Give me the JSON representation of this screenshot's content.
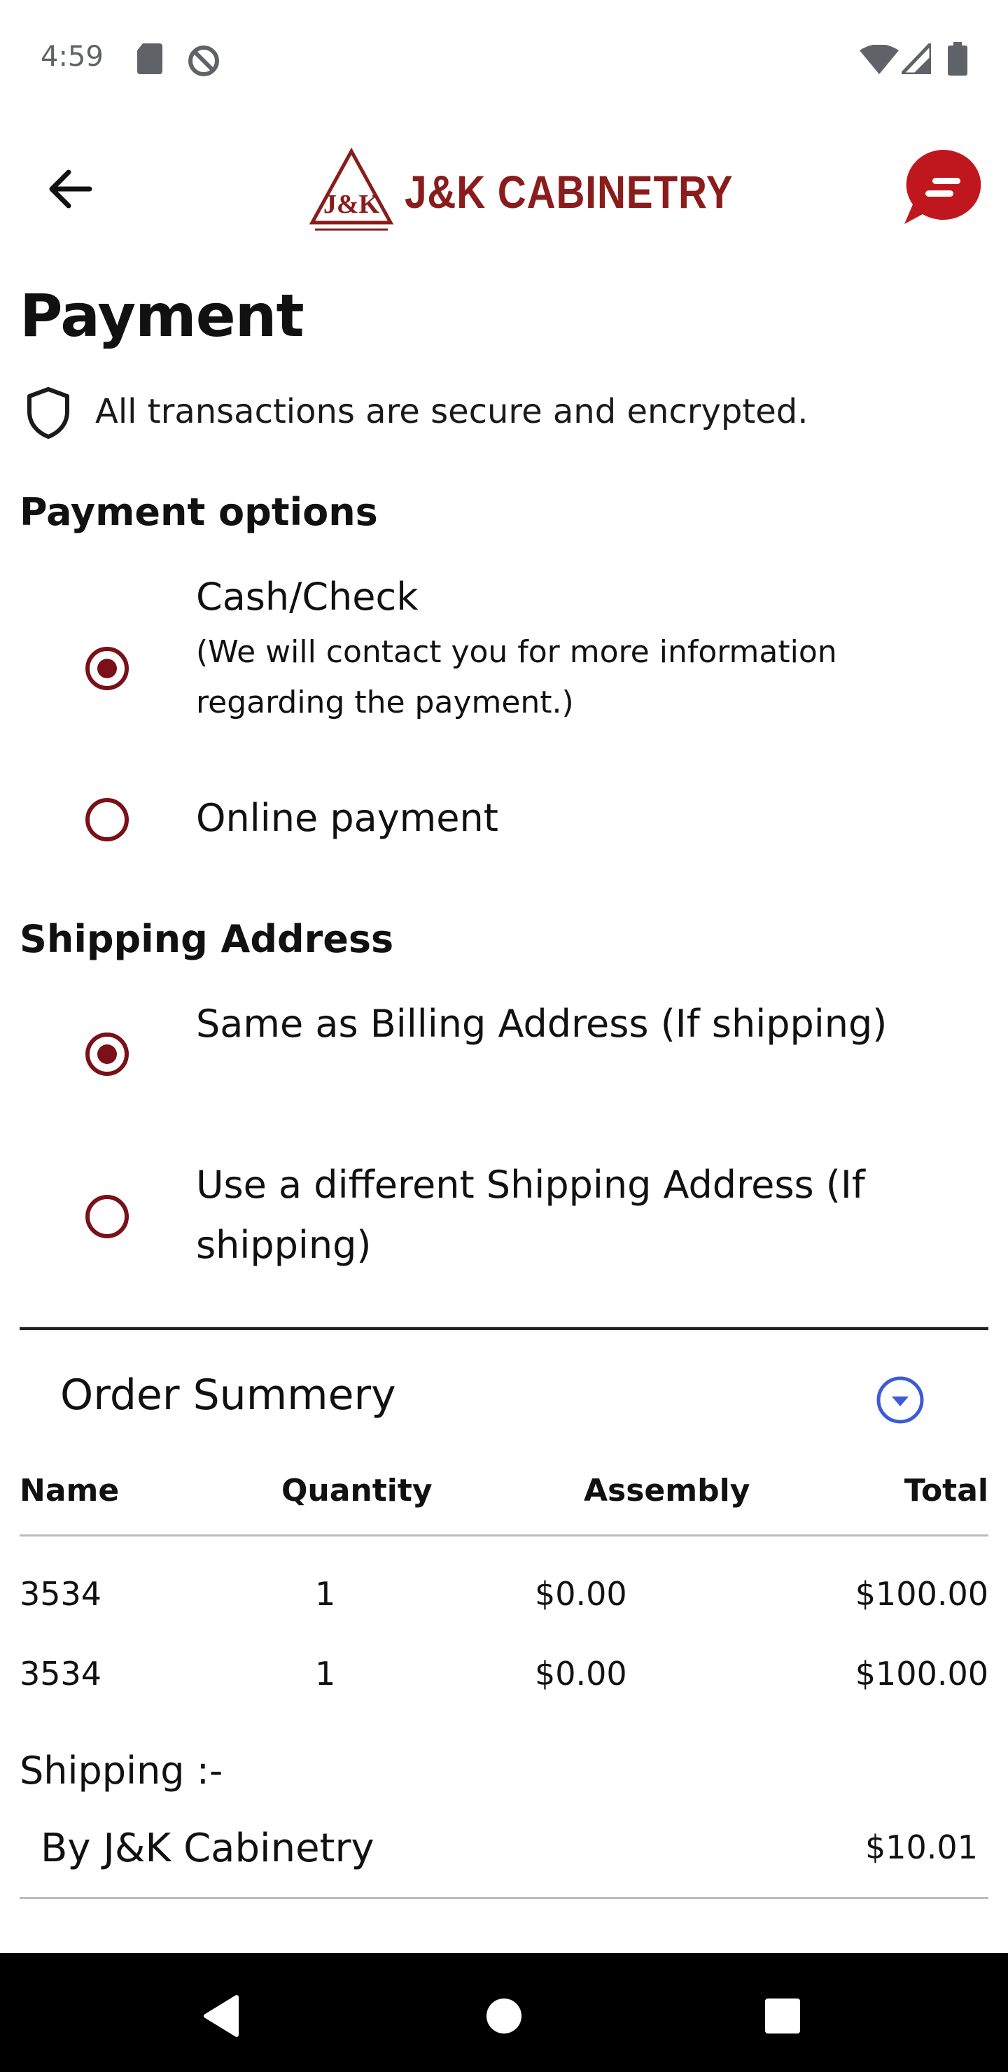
{
  "status_bar": {
    "time": "4:59",
    "icons": [
      "sd-card-icon",
      "sync-disabled-icon",
      "wifi-icon",
      "signal-icon",
      "battery-icon"
    ]
  },
  "header": {
    "logo_text": "J&K CABINETRY",
    "logo_emblem_text": "J&K",
    "icons": {
      "back": "arrow-left-icon",
      "chat": "chat-bubble-icon"
    }
  },
  "payment": {
    "title": "Payment",
    "secure_note": "All transactions are secure and encrypted.",
    "options_title": "Payment options",
    "options": [
      {
        "label": "Cash/Check",
        "sub": "(We will contact you for more information regarding the payment.)",
        "selected": true
      },
      {
        "label": "Online payment",
        "selected": false
      }
    ]
  },
  "shipping_address": {
    "title": "Shipping Address",
    "options": [
      {
        "label": "Same as Billing Address (If shipping)",
        "selected": true
      },
      {
        "label": "Use a different Shipping Address (If shipping)",
        "selected": false
      }
    ]
  },
  "order_summary": {
    "title": "Order Summery",
    "columns": [
      "Name",
      "Quantity",
      "Assembly",
      "Total"
    ],
    "rows": [
      {
        "name": "3534",
        "quantity": "1",
        "assembly": "$0.00",
        "total": "$100.00"
      },
      {
        "name": "3534",
        "quantity": "1",
        "assembly": "$0.00",
        "total": "$100.00"
      }
    ],
    "shipping_label": "Shipping :-",
    "shipping_method": "By J&K Cabinetry",
    "shipping_cost": "$10.01"
  },
  "colors": {
    "brand": "#8a1c1c",
    "radio": "#7a1018",
    "chat_bubble": "#c0171f",
    "expand_icon": "#3d5bd9"
  }
}
